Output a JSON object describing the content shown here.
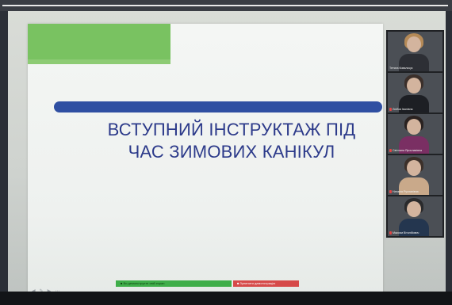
{
  "slide": {
    "title_line1": "ВСТУПНИЙ ІНСТРУКТАЖ ПІД",
    "title_line2": "ЧАС ЗИМОВИХ КАНІКУЛ",
    "accent_green": "#79c261",
    "accent_blue": "#2f4fa2",
    "title_color": "#2c3a8a"
  },
  "share_bar": {
    "info_label": "Ви демонструєте свій екран",
    "stop_label": "Зупинити демонстрацію",
    "info_color": "#3fae4a",
    "stop_color": "#d64a4a"
  },
  "slide_nav": {
    "prev_icon": "arrow-left-icon",
    "pen_icon": "pen-icon",
    "next_icon": "arrow-right-icon",
    "menu_icon": "menu-icon"
  },
  "participants": [
    {
      "name": "Тетяна Ковальчук",
      "muted": false
    },
    {
      "name": "Любов Іванівна",
      "muted": true
    },
    {
      "name": "Світлана Ярославівна",
      "muted": true
    },
    {
      "name": "Наталія Русланівна",
      "muted": true
    },
    {
      "name": "Максим Віталійович",
      "muted": true
    }
  ]
}
